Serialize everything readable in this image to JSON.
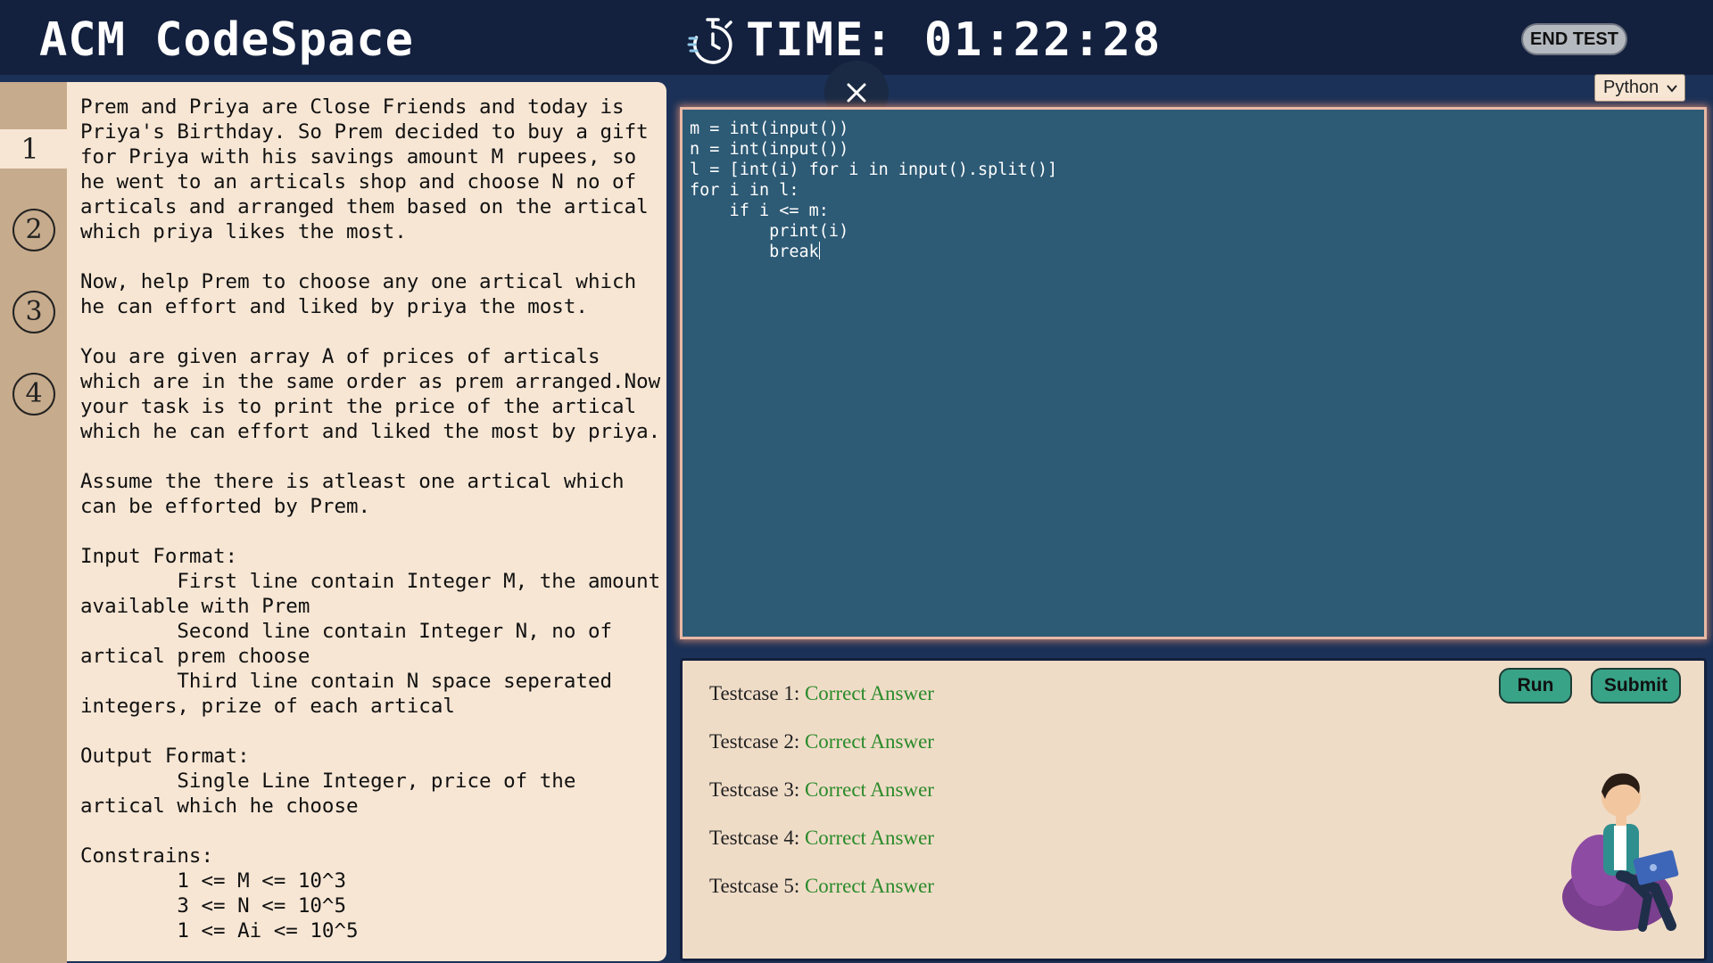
{
  "header": {
    "app_title": "ACM CodeSpace",
    "timer_text": "TIME: 01:22:28",
    "end_test_label": "END TEST"
  },
  "question_nav": {
    "items": [
      {
        "label": "1",
        "active": true
      },
      {
        "label": "2",
        "active": false
      },
      {
        "label": "3",
        "active": false
      },
      {
        "label": "4",
        "active": false
      }
    ]
  },
  "problem": {
    "text": "Prem and Priya are Close Friends and today is\nPriya's Birthday. So Prem decided to buy a gift\nfor Priya with his savings amount M rupees, so\nhe went to an articals shop and choose N no of\narticals and arranged them based on the artical\nwhich priya likes the most.\n\nNow, help Prem to choose any one artical which\nhe can effort and liked by priya the most.\n\nYou are given array A of prices of articals\nwhich are in the same order as prem arranged.Now\nyour task is to print the price of the artical\nwhich he can effort and liked the most by priya.\n\nAssume the there is atleast one artical which\ncan be efforted by Prem.\n\nInput Format:\n        First line contain Integer M, the amount\navailable with Prem\n        Second line contain Integer N, no of\nartical prem choose\n        Third line contain N space seperated\nintegers, prize of each artical\n\nOutput Format:\n        Single Line Integer, price of the\nartical which he choose\n\nConstrains:\n        1 <= M <= 10^3\n        3 <= N <= 10^5\n        1 <= Ai <= 10^5"
  },
  "editor": {
    "language": "Python",
    "code": "m = int(input())\nn = int(input())\nl = [int(i) for i in input().split()]\nfor i in l:\n    if i <= m:\n        print(i)\n        break"
  },
  "results": {
    "run_label": "Run",
    "submit_label": "Submit",
    "testcases": [
      {
        "label": "Testcase 1:",
        "status": "Correct Answer"
      },
      {
        "label": "Testcase 2:",
        "status": "Correct Answer"
      },
      {
        "label": "Testcase 3:",
        "status": "Correct Answer"
      },
      {
        "label": "Testcase 4:",
        "status": "Correct Answer"
      },
      {
        "label": "Testcase 5:",
        "status": "Correct Answer"
      }
    ]
  },
  "colors": {
    "header_bg": "#13203e",
    "page_bg": "#1b3157",
    "problem_bg": "#f7e6d4",
    "nav_bg": "#c6ab8c",
    "editor_bg": "#2d5a75",
    "results_bg": "#efdcc7",
    "correct_green": "#2a8a2a",
    "button_green": "#38a387"
  },
  "icons": {
    "timer": "stopwatch-icon",
    "close": "close-icon",
    "dropdown": "chevron-down-icon"
  }
}
